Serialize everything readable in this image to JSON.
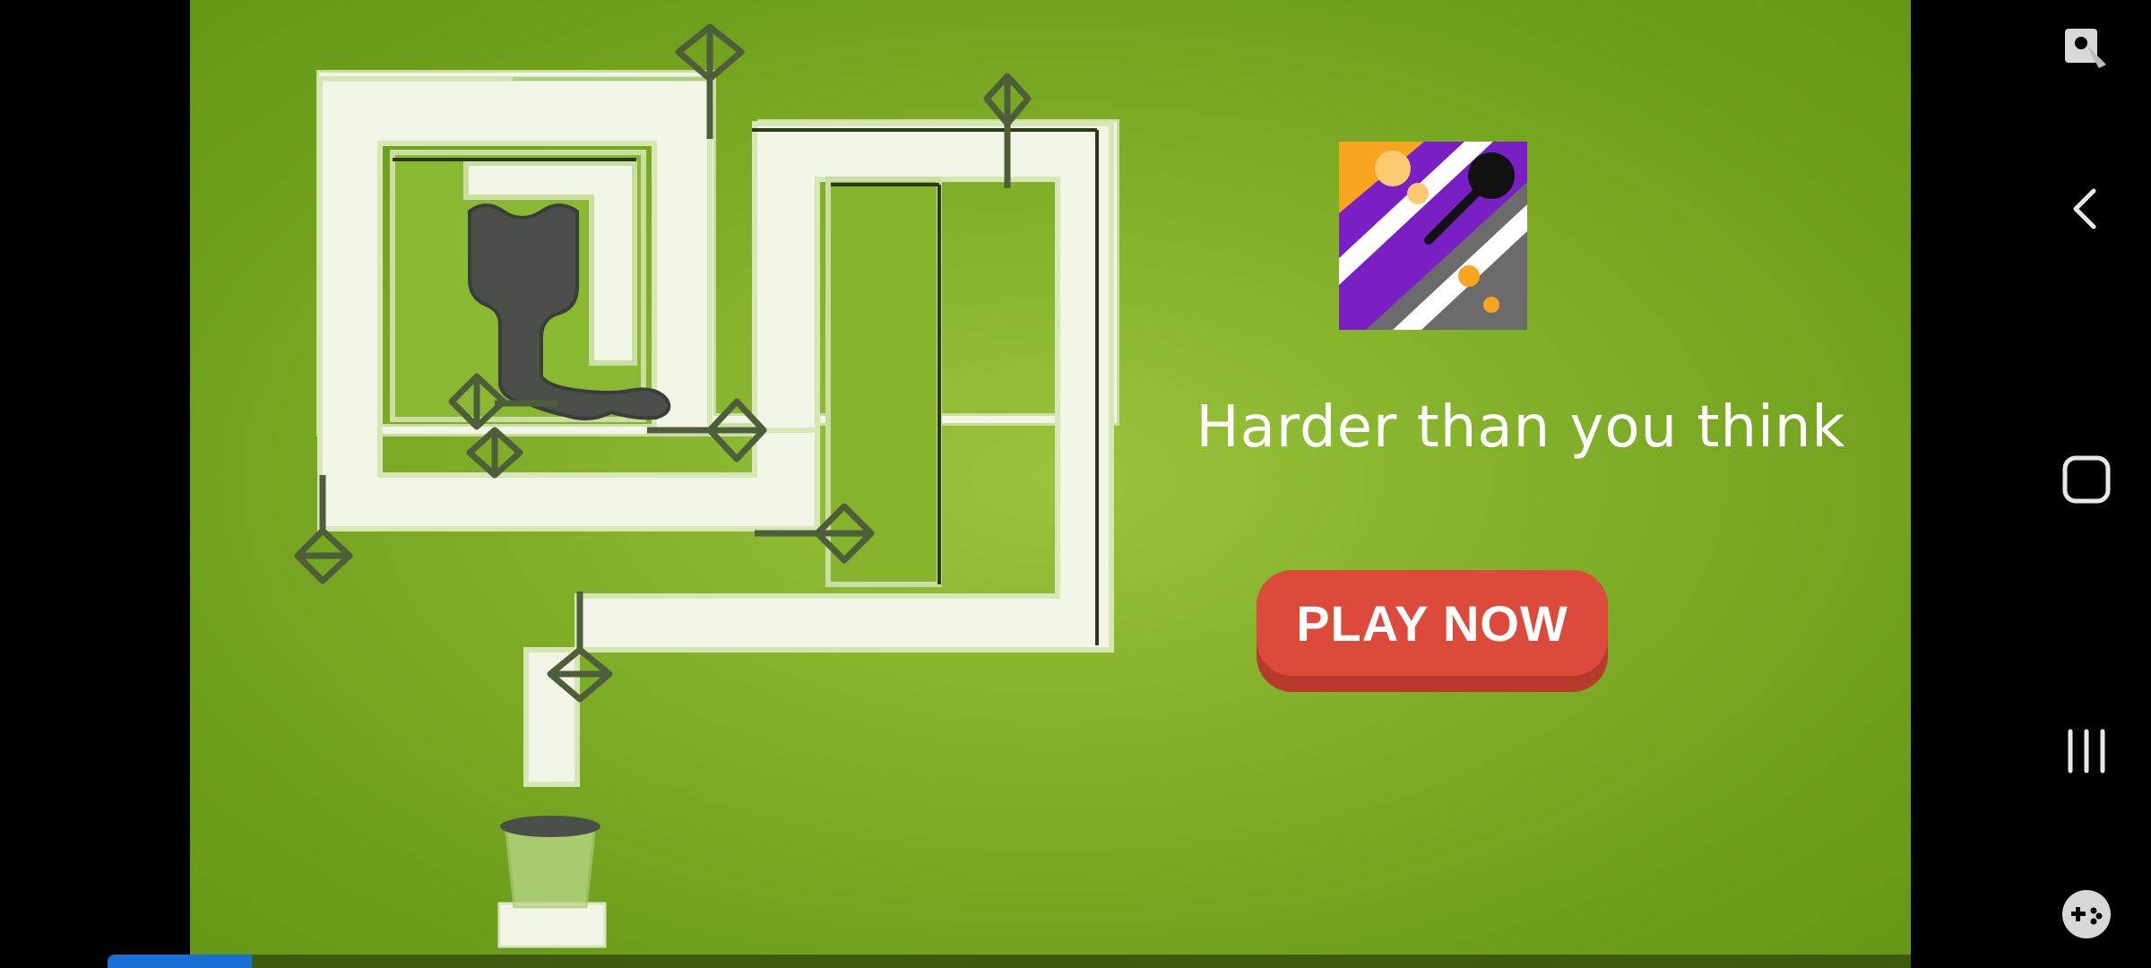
{
  "ad": {
    "tagline": "Harder than you think",
    "play_label": "PLAY NOW",
    "colors": {
      "background": "#86b22c",
      "button": "#db4a3a",
      "tagline": "#ffffff",
      "track": "#f2f6e6"
    }
  },
  "app_icon": {
    "icon": "pull-pin-game-icon",
    "colors": [
      "#f7a51e",
      "#7a1fc4",
      "#6b6b6b",
      "#111111"
    ]
  },
  "navigation": {
    "items": [
      {
        "name": "screenshot-assist-icon"
      },
      {
        "name": "back-icon"
      },
      {
        "name": "home-icon"
      },
      {
        "name": "recents-icon"
      },
      {
        "name": "game-tools-icon"
      }
    ]
  },
  "video_progress": {
    "fraction": 0.08,
    "color": "#1a6fd6"
  }
}
